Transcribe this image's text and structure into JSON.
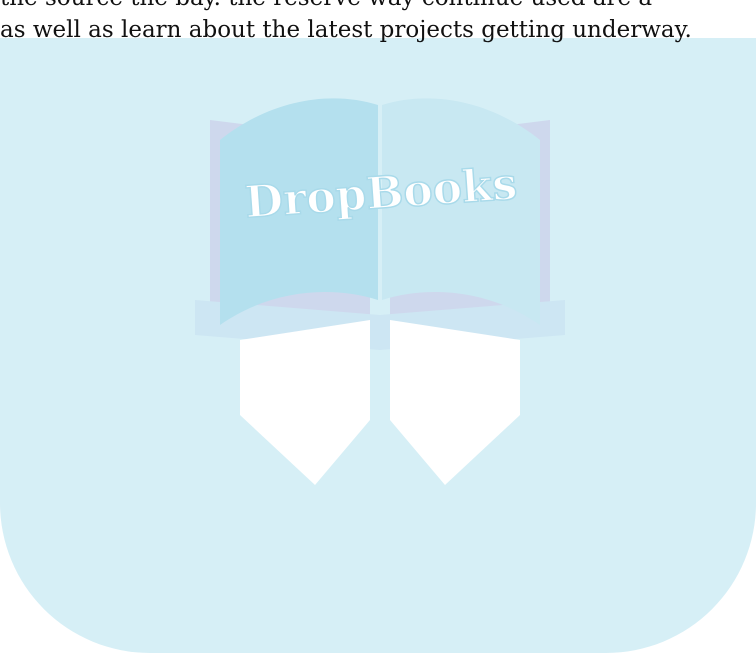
{
  "document": {
    "lines": [
      "the source the bay. the reserve way continue used are a",
      "as well as learn about the latest projects getting underway."
    ]
  },
  "watermark": {
    "brand_text": "DropBooks",
    "tile_color": "#d6eff6",
    "book_left_page_color": "#b4e0ee",
    "book_right_page_color": "#c8e8f2",
    "book_cover_color": "#c9c5e6",
    "text_color": "#ffffff",
    "text_outline_color": "#a9daea"
  }
}
